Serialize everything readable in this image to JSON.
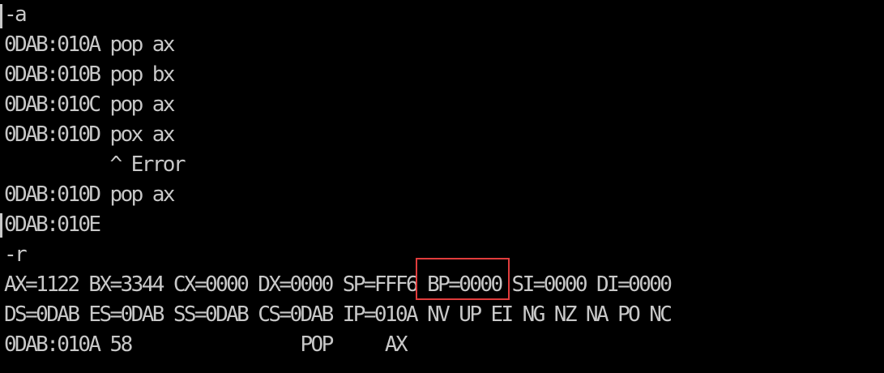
{
  "terminal": {
    "lines": [
      "-a",
      "0DAB:010A pop ax",
      "0DAB:010B pop bx",
      "0DAB:010C pop ax",
      "0DAB:010D pox ax",
      "          ^ Error",
      "0DAB:010D pop ax",
      "0DAB:010E",
      "-r",
      "AX=1122 BX=3344 CX=0000 DX=0000 SP=FFF6 BP=0000 SI=0000 DI=0000",
      "DS=0DAB ES=0DAB SS=0DAB CS=0DAB IP=010A NV UP EI NG NZ NA PO NC",
      "0DAB:010A 58                POP     AX"
    ],
    "highlight_label": "SP=FFF6",
    "colors": {
      "background": "#000000",
      "text": "#c8c8c8",
      "highlight_border": "#e03c3c"
    }
  }
}
